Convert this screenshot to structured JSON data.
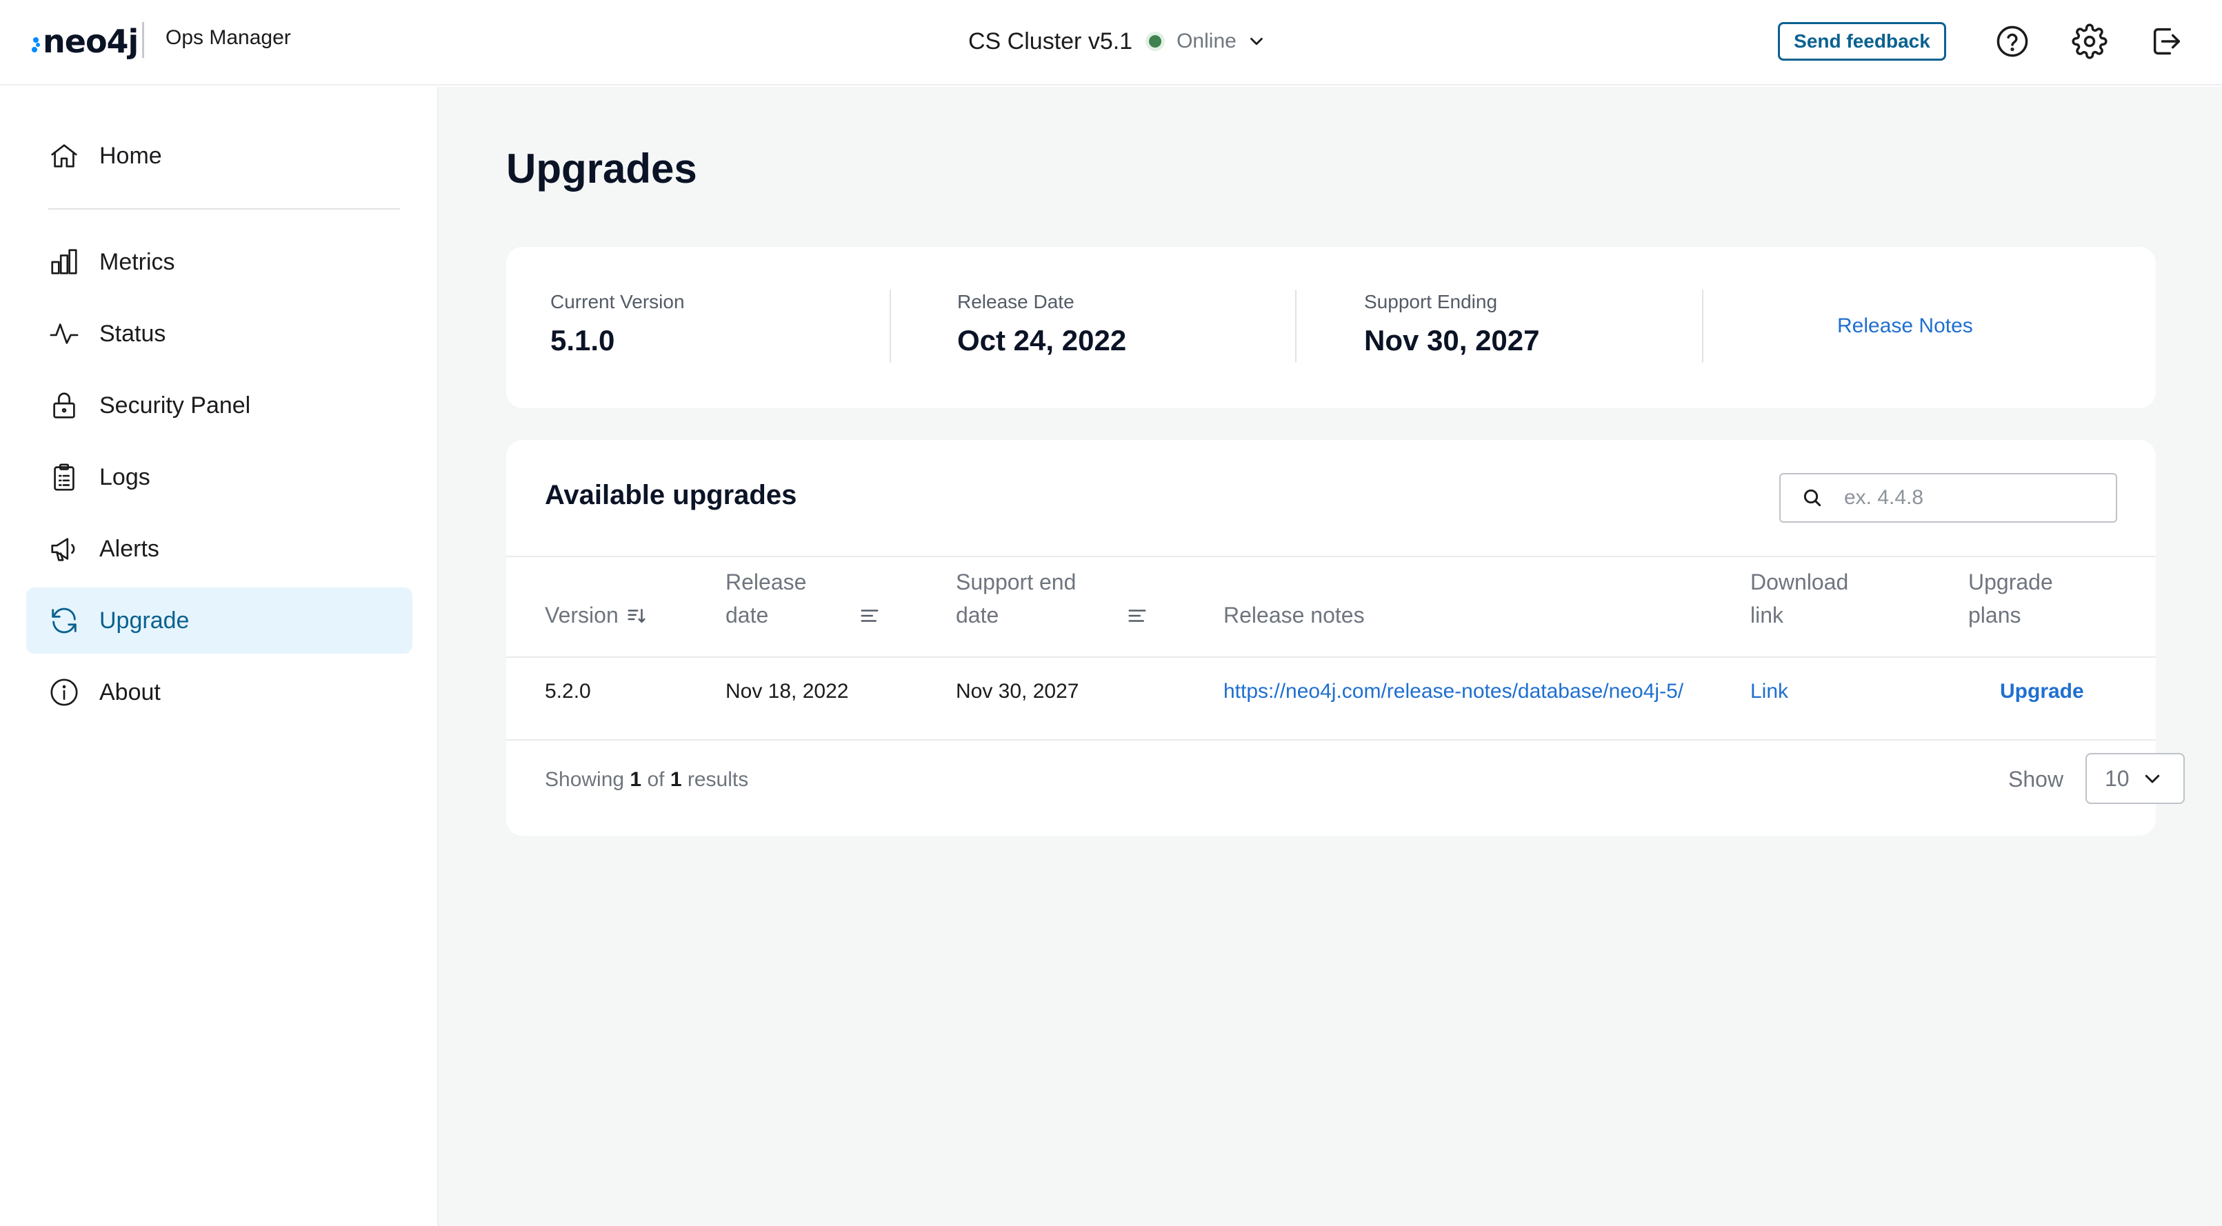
{
  "header": {
    "logo_text": "neo4j",
    "app_name": "Ops Manager",
    "cluster_name": "CS Cluster v5.1",
    "cluster_status": "Online",
    "feedback_label": "Send feedback",
    "status_color": "#3f824f",
    "icons": [
      "help-icon",
      "settings-icon",
      "logout-icon"
    ]
  },
  "sidebar": {
    "items": [
      {
        "label": "Home",
        "icon": "home-icon"
      },
      {
        "label": "Metrics",
        "icon": "bar-chart-icon"
      },
      {
        "label": "Status",
        "icon": "activity-icon"
      },
      {
        "label": "Security Panel",
        "icon": "lock-icon"
      },
      {
        "label": "Logs",
        "icon": "clipboard-icon"
      },
      {
        "label": "Alerts",
        "icon": "megaphone-icon"
      },
      {
        "label": "Upgrade",
        "icon": "refresh-icon",
        "active": true
      },
      {
        "label": "About",
        "icon": "info-icon"
      }
    ]
  },
  "main": {
    "title": "Upgrades",
    "info": {
      "current_version_label": "Current Version",
      "current_version": "5.1.0",
      "release_date_label": "Release Date",
      "release_date": "Oct 24, 2022",
      "support_ending_label": "Support Ending",
      "support_ending": "Nov 30, 2027",
      "release_notes_link": "Release Notes"
    },
    "upgrades": {
      "title": "Available upgrades",
      "search_placeholder": "ex. 4.4.8",
      "columns": {
        "version": "Version",
        "release_date_1": "Release",
        "release_date_2": "date",
        "support_end_1": "Support end",
        "support_end_2": "date",
        "release_notes": "Release notes",
        "download_1": "Download",
        "download_2": "link",
        "plans_1": "Upgrade",
        "plans_2": "plans"
      },
      "rows": [
        {
          "version": "5.2.0",
          "release_date": "Nov 18, 2022",
          "support_end": "Nov 30, 2027",
          "release_notes": "https://neo4j.com/release-notes/database/neo4j-5/",
          "download": "Link",
          "plans": "Upgrade"
        }
      ],
      "footer": {
        "showing": "Showing",
        "from": "1",
        "of": "of",
        "total": "1",
        "results": "results",
        "show_label": "Show",
        "page_size": "10"
      }
    }
  },
  "colors": {
    "accent": "#0a6190",
    "link": "#1f6fd0",
    "active_bg": "#e6f4fd",
    "main_bg": "#f5f6f6"
  }
}
